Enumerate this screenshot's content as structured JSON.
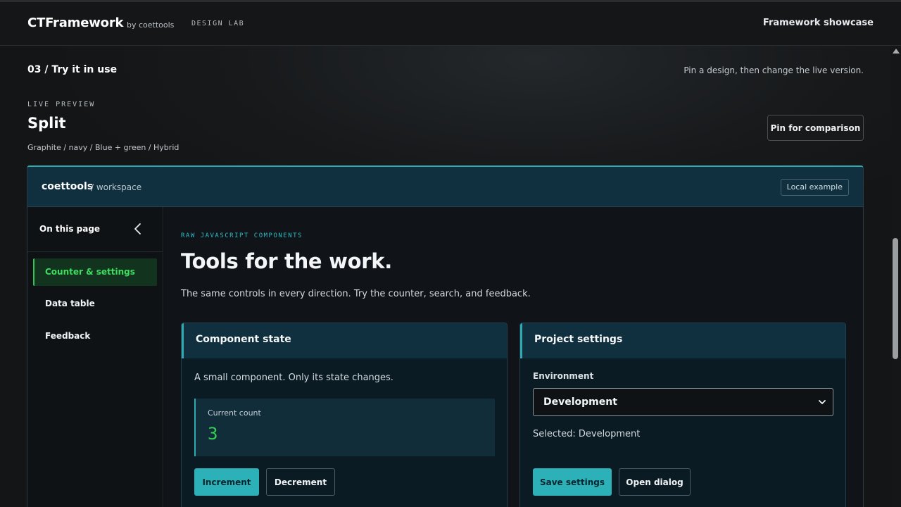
{
  "topbar": {
    "brand": "CTFramework",
    "by": "by coettools",
    "lab": "DESIGN LAB",
    "showcase": "Framework showcase"
  },
  "section": {
    "title": "03 / Try it in use",
    "hint": "Pin a design, then change the live version."
  },
  "preview": {
    "eyebrow": "LIVE PREVIEW",
    "name": "Split",
    "subtitle": "Graphite / navy / Blue + green / Hybrid",
    "pin_label": "Pin for comparison"
  },
  "workspace": {
    "name": "coettools",
    "path": "/ workspace",
    "badge": "Local example"
  },
  "sidebar": {
    "title": "On this page",
    "items": [
      {
        "label": "Counter & settings",
        "active": true
      },
      {
        "label": "Data table",
        "active": false
      },
      {
        "label": "Feedback",
        "active": false
      }
    ]
  },
  "main": {
    "kicker": "RAW JAVASCRIPT COMPONENTS",
    "headline": "Tools for the work.",
    "lead": "The same controls in every direction. Try the counter, search, and feedback."
  },
  "component_card": {
    "title": "Component state",
    "description": "A small component. Only its state changes.",
    "count_label": "Current count",
    "count_value": "3",
    "increment_label": "Increment",
    "decrement_label": "Decrement"
  },
  "settings_card": {
    "title": "Project settings",
    "field_label": "Environment",
    "selected_value": "Development",
    "selected_text": "Selected: Development",
    "save_label": "Save settings",
    "dialog_label": "Open dialog"
  },
  "colors": {
    "accent_teal": "#2fa9b2",
    "accent_green": "#35cf55",
    "header_navy": "#10303f",
    "background": "#141516"
  }
}
